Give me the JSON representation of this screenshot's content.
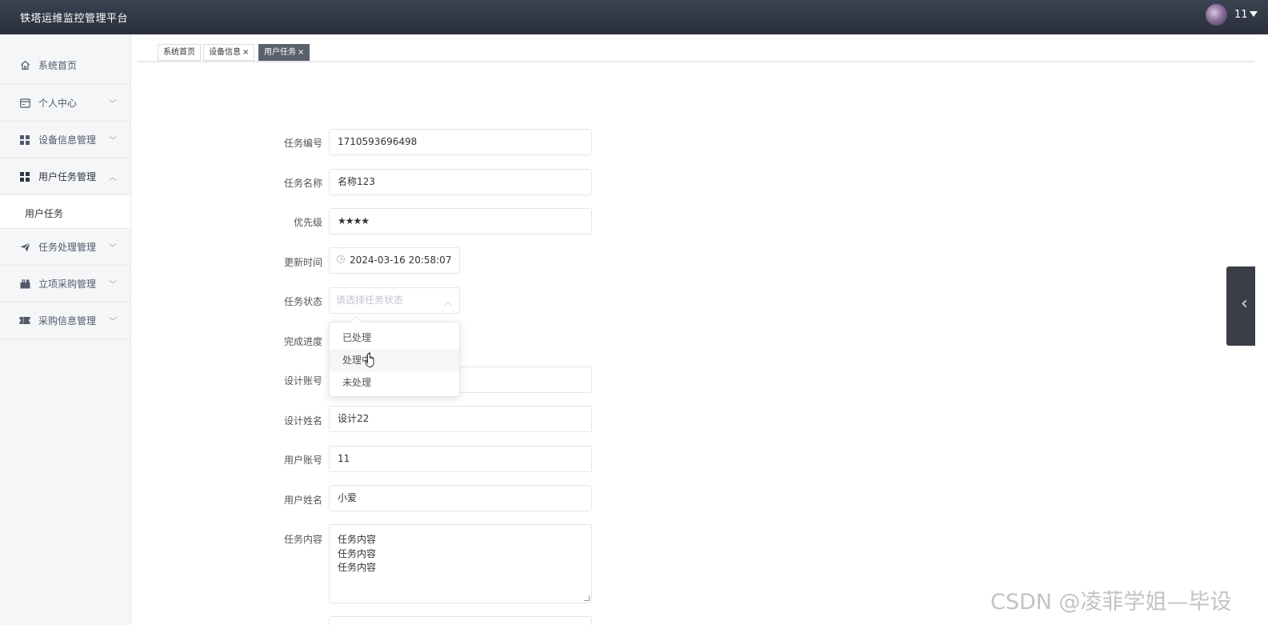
{
  "app": {
    "title": "铁塔运维监控管理平台",
    "user_name": "11"
  },
  "sidebar": {
    "items": [
      {
        "label": "系统首页",
        "icon": "home-icon"
      },
      {
        "label": "个人中心",
        "icon": "card-icon",
        "arrow": "﹀"
      },
      {
        "label": "设备信息管理",
        "icon": "grid-icon",
        "arrow": "﹀"
      },
      {
        "label": "用户任务管理",
        "icon": "grid-icon",
        "arrow": "︿"
      },
      {
        "label": "任务处理管理",
        "icon": "send-icon",
        "arrow": "﹀"
      },
      {
        "label": "立项采购管理",
        "icon": "briefcase-icon",
        "arrow": "﹀"
      },
      {
        "label": "采购信息管理",
        "icon": "ticket-icon",
        "arrow": "﹀"
      }
    ],
    "subitem": "用户任务"
  },
  "tabs": [
    {
      "label": "系统首页",
      "close": ""
    },
    {
      "label": "设备信息",
      "close": "×"
    },
    {
      "label": "用户任务",
      "close": "×"
    }
  ],
  "form": {
    "task_no": {
      "label": "任务编号",
      "value": "1710593696498"
    },
    "task_name": {
      "label": "任务名称",
      "value": "名称123"
    },
    "priority": {
      "label": "优先级",
      "value": "★★★★"
    },
    "update_time": {
      "label": "更新时间",
      "value": "2024-03-16 20:58:07"
    },
    "task_status": {
      "label": "任务状态",
      "placeholder": "请选择任务状态"
    },
    "progress": {
      "label": "完成进度"
    },
    "designer_account": {
      "label": "设计账号"
    },
    "designer_name": {
      "label": "设计姓名",
      "value": "设计22"
    },
    "user_account": {
      "label": "用户账号",
      "value": "11"
    },
    "user_name": {
      "label": "用户姓名",
      "value": "小爱"
    },
    "task_content": {
      "label": "任务内容",
      "lines": [
        "任务内容",
        "任务内容",
        "任务内容"
      ]
    }
  },
  "status_options": [
    "已处理",
    "处理中",
    "未处理"
  ],
  "watermark": "CSDN @凌菲学姐—毕设",
  "colors": {
    "topbar": "#2f3541",
    "active_tab": "#5a616d",
    "sidebar_bg": "#f5f6f8"
  }
}
